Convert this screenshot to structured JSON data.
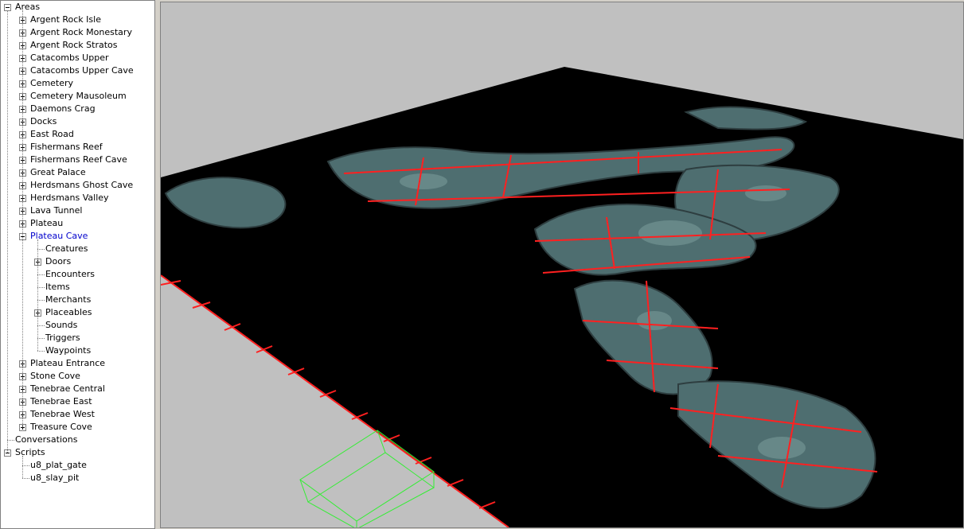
{
  "tree": {
    "root": "Areas",
    "areas": [
      {
        "label": "Argent Rock Isle"
      },
      {
        "label": "Argent Rock Monestary"
      },
      {
        "label": "Argent Rock Stratos"
      },
      {
        "label": "Catacombs Upper"
      },
      {
        "label": "Catacombs Upper Cave"
      },
      {
        "label": "Cemetery"
      },
      {
        "label": "Cemetery Mausoleum"
      },
      {
        "label": "Daemons Crag"
      },
      {
        "label": "Docks"
      },
      {
        "label": "East Road"
      },
      {
        "label": "Fishermans Reef"
      },
      {
        "label": "Fishermans Reef Cave"
      },
      {
        "label": "Great Palace"
      },
      {
        "label": "Herdsmans Ghost Cave"
      },
      {
        "label": "Herdsmans Valley"
      },
      {
        "label": "Lava Tunnel"
      },
      {
        "label": "Plateau"
      },
      {
        "label": "Plateau Cave"
      },
      {
        "label": "Plateau Entrance"
      },
      {
        "label": "Stone Cove"
      },
      {
        "label": "Tenebrae Central"
      },
      {
        "label": "Tenebrae East"
      },
      {
        "label": "Tenebrae West"
      },
      {
        "label": "Treasure Cove"
      }
    ],
    "selected_area": "Plateau Cave",
    "selected_children": [
      {
        "label": "Creatures",
        "expandable": false
      },
      {
        "label": "Doors",
        "expandable": true
      },
      {
        "label": "Encounters",
        "expandable": false
      },
      {
        "label": "Items",
        "expandable": false
      },
      {
        "label": "Merchants",
        "expandable": false
      },
      {
        "label": "Placeables",
        "expandable": true
      },
      {
        "label": "Sounds",
        "expandable": false
      },
      {
        "label": "Triggers",
        "expandable": false
      },
      {
        "label": "Waypoints",
        "expandable": false
      }
    ],
    "conversations": "Conversations",
    "scripts": {
      "label": "Scripts",
      "items": [
        {
          "label": "u8_plat_gate"
        },
        {
          "label": "u8_slay_pit"
        }
      ]
    }
  },
  "viewport": {
    "background": "#c0c0c0",
    "ground": "#000000",
    "grid_color": "#ff2020",
    "trigger_color": "#33ee33",
    "cave_color": "#4e6e70"
  }
}
